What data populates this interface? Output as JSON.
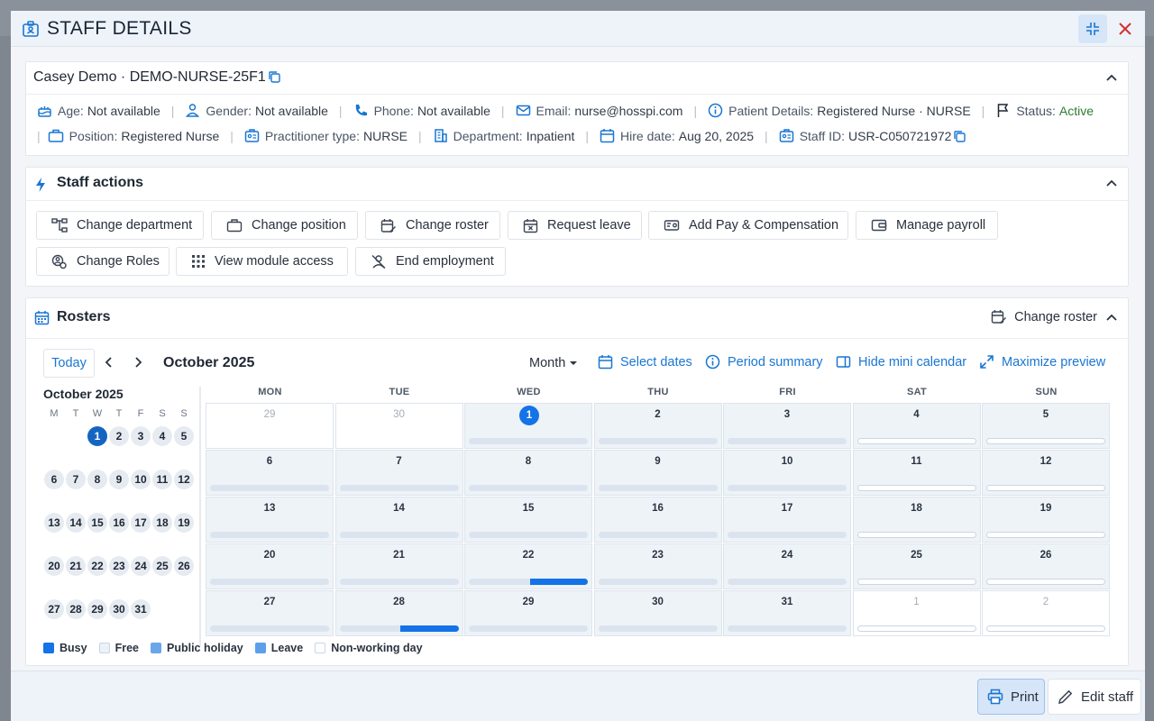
{
  "modal": {
    "title": "STAFF DETAILS"
  },
  "identity": {
    "name_line": "Casey Demo · DEMO-NURSE-25F1",
    "row1": [
      {
        "key": "Age:",
        "value": "Not available",
        "icon": "age-icon"
      },
      {
        "key": "Gender:",
        "value": "Not available",
        "icon": "person-icon"
      },
      {
        "key": "Phone:",
        "value": "Not available",
        "icon": "phone-icon"
      },
      {
        "key": "Email:",
        "value": "nurse@hosspi.com",
        "icon": "email-icon"
      },
      {
        "key": "Patient Details:",
        "value": "Registered Nurse · NURSE",
        "icon": "info-icon"
      },
      {
        "key": "Status:",
        "value": "Active",
        "icon": "flag-icon"
      }
    ],
    "row2": [
      {
        "key": "Position:",
        "value": "Registered Nurse",
        "icon": "briefcase-icon"
      },
      {
        "key": "Practitioner type:",
        "value": "NURSE",
        "icon": "badge-icon"
      },
      {
        "key": "Department:",
        "value": "Inpatient",
        "icon": "building-icon"
      },
      {
        "key": "Hire date:",
        "value": "Aug 20, 2025",
        "icon": "calendar-icon"
      },
      {
        "key": "Staff ID:",
        "value": "USR-C050721972",
        "icon": "id-card-icon"
      }
    ]
  },
  "actions": {
    "title": "Staff actions",
    "buttons": [
      "Change department",
      "Change position",
      "Change roster",
      "Request leave",
      "Add Pay & Compensation",
      "Manage payroll",
      "Change Roles",
      "View module access",
      "End employment"
    ]
  },
  "rosters": {
    "title": "Rosters",
    "change_roster": "Change roster",
    "today": "Today",
    "month_title": "October 2025",
    "view": "Month",
    "links": [
      "Select dates",
      "Period summary",
      "Hide mini calendar",
      "Maximize preview"
    ],
    "mini": {
      "title": "October 2025",
      "dow": [
        "M",
        "T",
        "W",
        "T",
        "F",
        "S",
        "S"
      ],
      "weeks": [
        [
          "",
          "",
          "1",
          "2",
          "3",
          "4",
          "5"
        ],
        [
          "6",
          "7",
          "8",
          "9",
          "10",
          "11",
          "12"
        ],
        [
          "13",
          "14",
          "15",
          "16",
          "17",
          "18",
          "19"
        ],
        [
          "20",
          "21",
          "22",
          "23",
          "24",
          "25",
          "26"
        ],
        [
          "27",
          "28",
          "29",
          "30",
          "31",
          "",
          ""
        ]
      ],
      "selected": "1"
    },
    "grid_headers": [
      "MON",
      "TUE",
      "WED",
      "THU",
      "FRI",
      "SAT",
      "SUN"
    ],
    "grid_weeks": [
      [
        "29",
        "30",
        "1",
        "2",
        "3",
        "4",
        "5"
      ],
      [
        "6",
        "7",
        "8",
        "9",
        "10",
        "11",
        "12"
      ],
      [
        "13",
        "14",
        "15",
        "16",
        "17",
        "18",
        "19"
      ],
      [
        "20",
        "21",
        "22",
        "23",
        "24",
        "25",
        "26"
      ],
      [
        "27",
        "28",
        "29",
        "30",
        "31",
        "1",
        "2"
      ]
    ],
    "legend": [
      {
        "label": "Busy",
        "color": "#1473e6"
      },
      {
        "label": "Free",
        "color": "#eaf1f9"
      },
      {
        "label": "Public holiday",
        "color": "#6aa6ea"
      },
      {
        "label": "Leave",
        "color": "#5e9eea"
      },
      {
        "label": "Non-working day",
        "color": "#ffffff"
      }
    ]
  },
  "footer": {
    "print": "Print",
    "edit": "Edit staff"
  }
}
